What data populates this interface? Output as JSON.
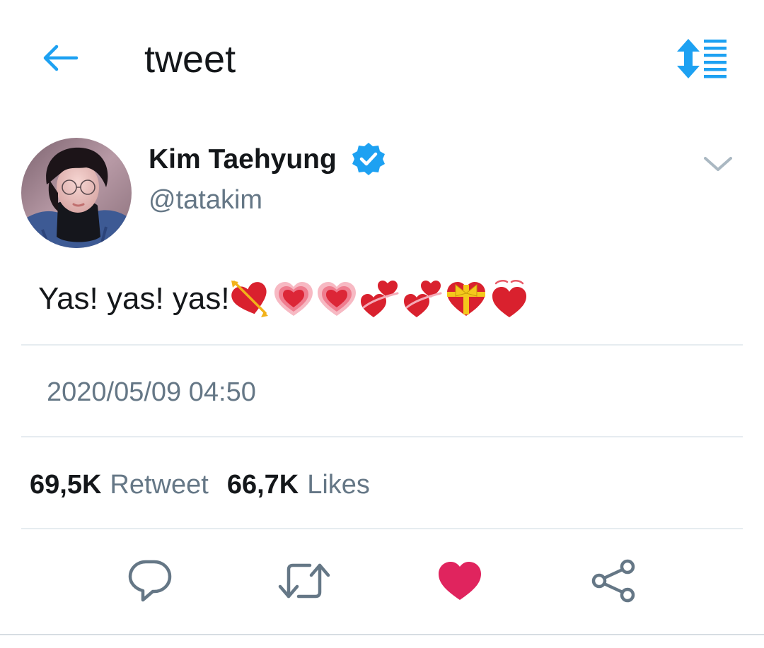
{
  "header": {
    "title": "tweet",
    "back_icon": "arrow-left-icon",
    "sort_icon": "sort-toggle-icon",
    "accent_color": "#1da1f2"
  },
  "author": {
    "name": "Kim Taehyung",
    "handle": "@tatakim",
    "verified": true,
    "verified_color": "#1da1f2"
  },
  "tweet": {
    "text": "Yas! yas! yas!",
    "emojis": [
      "heart-with-arrow-emoji",
      "growing-heart-emoji",
      "growing-heart-emoji",
      "two-hearts-emoji",
      "two-hearts-emoji",
      "heart-with-ribbon-emoji",
      "beating-heart-emoji"
    ],
    "timestamp": "2020/05/09 04:50"
  },
  "stats": {
    "retweets_count": "69,5K",
    "retweets_label": "Retweet",
    "likes_count": "66,7K",
    "likes_label": "Likes"
  },
  "actions": [
    {
      "icon": "reply-icon"
    },
    {
      "icon": "retweet-icon"
    },
    {
      "icon": "like-heart-icon",
      "active": true,
      "color": "#e0245e"
    },
    {
      "icon": "share-icon"
    }
  ]
}
